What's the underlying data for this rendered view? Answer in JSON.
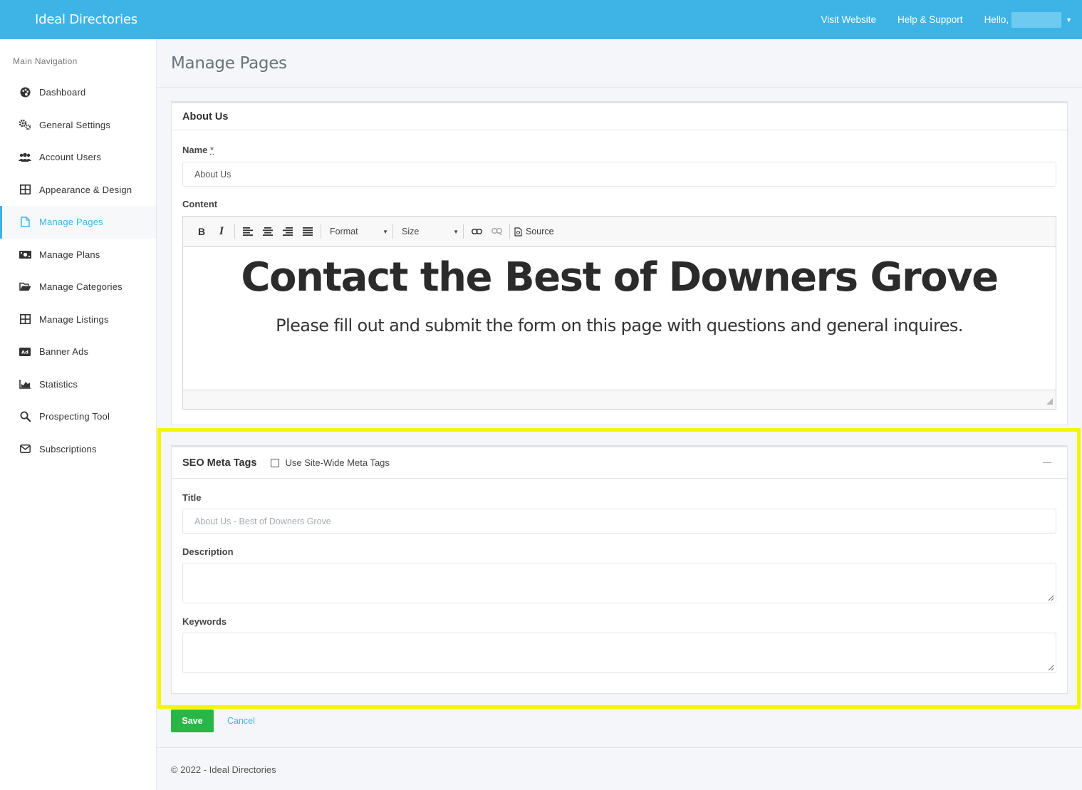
{
  "topbar": {
    "brand": "Ideal Directories",
    "links": [
      "Visit Website",
      "Help & Support"
    ],
    "hello": "Hello,"
  },
  "sidebar": {
    "heading": "Main Navigation",
    "items": [
      {
        "label": "Dashboard",
        "icon": "palette-icon"
      },
      {
        "label": "General Settings",
        "icon": "cogs-icon"
      },
      {
        "label": "Account Users",
        "icon": "users-icon"
      },
      {
        "label": "Appearance & Design",
        "icon": "grid-icon"
      },
      {
        "label": "Manage Pages",
        "icon": "file-icon",
        "active": true
      },
      {
        "label": "Manage Plans",
        "icon": "money-icon"
      },
      {
        "label": "Manage Categories",
        "icon": "folder-open-icon"
      },
      {
        "label": "Manage Listings",
        "icon": "grid-icon"
      },
      {
        "label": "Banner Ads",
        "icon": "ad-icon"
      },
      {
        "label": "Statistics",
        "icon": "area-chart-icon"
      },
      {
        "label": "Prospecting Tool",
        "icon": "search-icon"
      },
      {
        "label": "Subscriptions",
        "icon": "envelope-icon"
      }
    ]
  },
  "page": {
    "title": "Manage Pages"
  },
  "page_card": {
    "title": "About Us",
    "name_label": "Name",
    "name_required": "*",
    "name_value": "About Us",
    "content_label": "Content",
    "toolbar": {
      "format": "Format",
      "size": "Size",
      "source": "Source"
    },
    "content_heading": "Contact the Best of Downers Grove",
    "content_paragraph": "Please fill out and submit the form on this page with questions and general inquires."
  },
  "seo": {
    "title": "SEO Meta Tags",
    "sitewide_label": "Use Site-Wide Meta Tags",
    "sitewide_checked": false,
    "title_label": "Title",
    "title_placeholder": "About Us - Best of Downers Grove",
    "description_label": "Description",
    "keywords_label": "Keywords"
  },
  "actions": {
    "save": "Save",
    "cancel": "Cancel"
  },
  "footer": "© 2022 - Ideal Directories",
  "colors": {
    "brand": "#3db4e5",
    "save": "#28b747",
    "highlight": "#f5f502"
  }
}
